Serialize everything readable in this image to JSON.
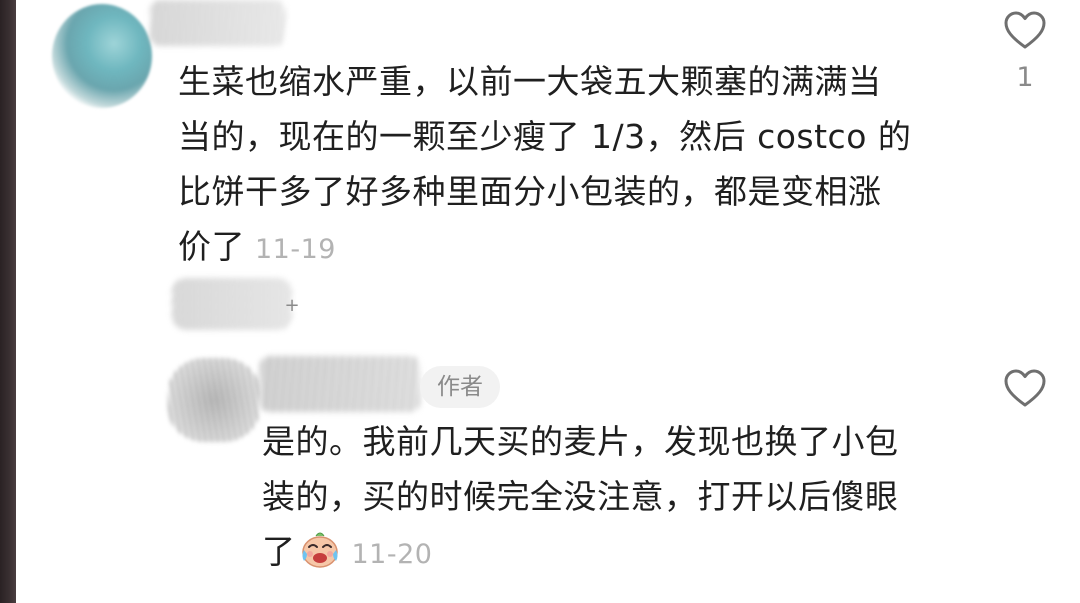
{
  "comments": [
    {
      "lines": [
        "生菜也缩水严重，以前一大袋五大颗塞的满满当",
        "当的，现在的一颗至少瘦了 1/3，然后 costco 的",
        "比饼干多了好多种里面分小包装的，都是变相涨",
        "价了"
      ],
      "date": "11-19",
      "likes": "1",
      "like_icon": "heart-outline-icon"
    }
  ],
  "reply": {
    "author_badge": "作者",
    "lines": [
      "是的。我前几天买的麦片，发现也换了小包",
      "装的，买的时候完全没注意，打开以后傻眼",
      "了"
    ],
    "emoji": "crying-laughing-emoji-icon",
    "date": "11-20",
    "like_icon": "heart-outline-icon"
  },
  "expand_replies_icon": "plus-icon",
  "colors": {
    "text": "#1f1f1f",
    "meta": "#b3b3b3",
    "icon": "#8a8a8a",
    "badge_bg": "#f2f2f2"
  }
}
